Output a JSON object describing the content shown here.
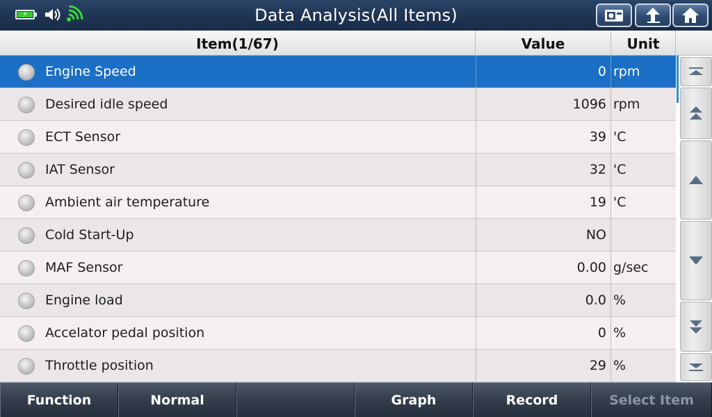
{
  "header": {
    "title": "Data Analysis(All Items)"
  },
  "status_icons": [
    "battery-charging-icon",
    "speaker-icon",
    "wifi-icon"
  ],
  "top_buttons": [
    "screenshot-icon",
    "back-icon",
    "home-icon"
  ],
  "table": {
    "columns": {
      "item": "Item(1/67)",
      "value": "Value",
      "unit": "Unit"
    },
    "rows": [
      {
        "name": "Engine Speed",
        "value": "0",
        "unit": "rpm"
      },
      {
        "name": "Desired idle speed",
        "value": "1096",
        "unit": "rpm"
      },
      {
        "name": "ECT Sensor",
        "value": "39",
        "unit": "'C"
      },
      {
        "name": "IAT Sensor",
        "value": "32",
        "unit": "'C"
      },
      {
        "name": "Ambient air temperature",
        "value": "19",
        "unit": "'C"
      },
      {
        "name": "Cold Start-Up",
        "value": "NO",
        "unit": ""
      },
      {
        "name": "MAF Sensor",
        "value": "0.00",
        "unit": "g/sec"
      },
      {
        "name": "Engine load",
        "value": "0.0",
        "unit": "%"
      },
      {
        "name": "Accelator pedal position",
        "value": "0",
        "unit": "%"
      },
      {
        "name": "Throttle position",
        "value": "29",
        "unit": "%"
      }
    ],
    "selected_index": 0
  },
  "scroll_buttons": [
    "first-page-icon",
    "page-up-icon",
    "line-up-icon",
    "line-down-icon",
    "page-down-icon",
    "last-page-icon"
  ],
  "footer": {
    "buttons": [
      {
        "label": "Function",
        "enabled": true
      },
      {
        "label": "Normal",
        "enabled": true
      },
      {
        "label": "",
        "enabled": true
      },
      {
        "label": "Graph",
        "enabled": true
      },
      {
        "label": "Record",
        "enabled": true
      },
      {
        "label": "Select Item",
        "enabled": false
      }
    ]
  },
  "colors": {
    "topbar": "#1f3352",
    "selected_row": "#1b6fc4",
    "row_odd": "#f6efef",
    "row_even": "#ebe6e7",
    "bottombar": "#333d4c",
    "battery_fill": "#33cc33",
    "wifi": "#33dd33"
  }
}
